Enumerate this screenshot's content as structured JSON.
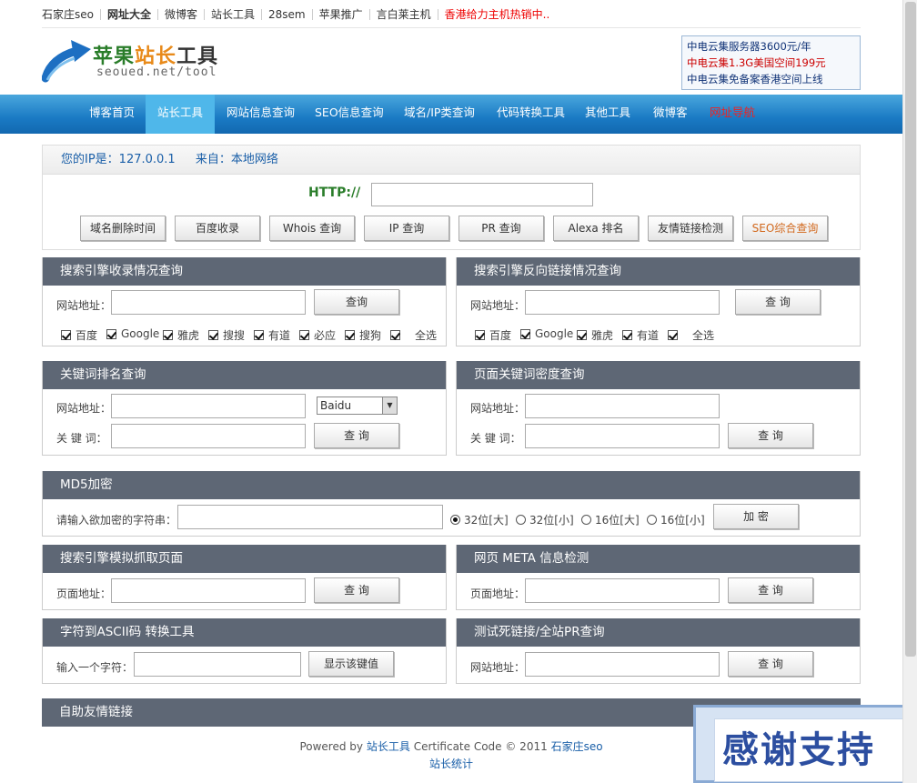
{
  "toplinks": [
    "石家庄seo",
    "网址大全",
    "微博客",
    "站长工具",
    "28sem",
    "苹果推广",
    "言白莱主机",
    "香港给力主机热销中.."
  ],
  "logo": {
    "title_a": "苹果",
    "title_b": "站长",
    "title_c": "工具",
    "sub": "seoued.net/tool"
  },
  "ad": [
    "中电云集服务器3600元/年",
    "中电云集1.3G美国空间199元",
    "中电云集免备案香港空间上线"
  ],
  "nav": [
    "博客首页",
    "站长工具",
    "网站信息查询",
    "SEO信息查询",
    "域名/IP类查询",
    "代码转换工具",
    "其他工具",
    "微博客",
    "网址导航"
  ],
  "ipinfo": {
    "ip": "您的IP是：127.0.0.1",
    "from": "来自：本地网络"
  },
  "http_label": "HTTP://",
  "tool_buttons": [
    "域名删除时间",
    "百度收录",
    "Whois 查询",
    "IP 查询",
    "PR 查询",
    "Alexa 排名",
    "友情链接检测",
    "SEO综合查询"
  ],
  "panels": {
    "index": {
      "title": "搜索引擎收录情况查询",
      "url_label": "网站地址：",
      "button": "查询",
      "checks": [
        "百度",
        "Google",
        "雅虎",
        "搜搜",
        "有道",
        "必应",
        "搜狗",
        "全选"
      ]
    },
    "backlink": {
      "title": "搜索引擎反向链接情况查询",
      "url_label": "网站地址：",
      "button": "查 询",
      "checks": [
        "百度",
        "Google",
        "雅虎",
        "有道",
        "全选"
      ]
    },
    "rank": {
      "title": "关键词排名查询",
      "url_label": "网站地址：",
      "kw_label": "关 键 词：",
      "select": "Baidu",
      "button": "查 询"
    },
    "density": {
      "title": "页面关键词密度查询",
      "url_label": "网站地址：",
      "kw_label": "关 键 词：",
      "button": "查 询"
    },
    "md5": {
      "title": "MD5加密",
      "label": "请输入欲加密的字符串：",
      "options": [
        "32位[大]",
        "32位[小]",
        "16位[大]",
        "16位[小]"
      ],
      "button": "加 密"
    },
    "spider": {
      "title": "搜索引擎模拟抓取页面",
      "url_label": "页面地址：",
      "button": "查 询"
    },
    "meta": {
      "title": "网页 META 信息检测",
      "url_label": "页面地址：",
      "button": "查 询"
    },
    "ascii": {
      "title": "字符到ASCII码 转换工具",
      "label": "输入一个字符：",
      "button": "显示该键值"
    },
    "deadlink": {
      "title": "测试死链接/全站PR查询",
      "url_label": "网站地址：",
      "button": "查 询"
    },
    "friend": {
      "title": "自助友情链接"
    }
  },
  "footer": {
    "powered": "Powered by",
    "site": "站长工具",
    "cert": "Certificate Code © 2011",
    "author": "石家庄seo",
    "stats": "站长统计"
  },
  "float_text": "感谢支持"
}
